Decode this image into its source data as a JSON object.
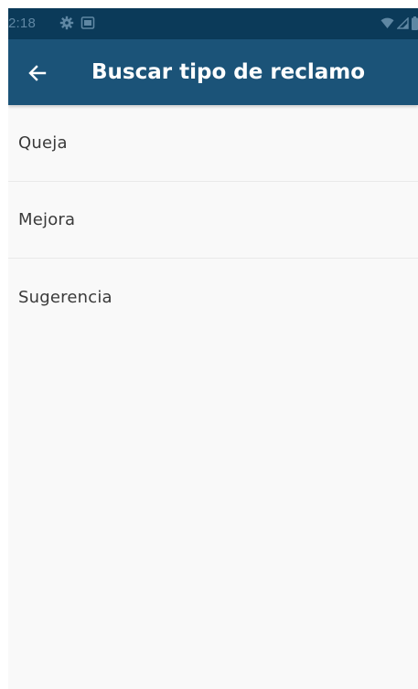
{
  "status_bar": {
    "time": "2:18",
    "left_icons": [
      "gear-icon",
      "image-icon"
    ],
    "right_icons": [
      "wifi-icon",
      "signal-icon",
      "battery-icon"
    ]
  },
  "app_bar": {
    "back_icon": "arrow-left-icon",
    "title": "Buscar tipo de reclamo"
  },
  "list": {
    "items": [
      {
        "label": "Queja"
      },
      {
        "label": "Mejora"
      },
      {
        "label": "Sugerencia"
      }
    ]
  },
  "colors": {
    "status_bar_bg": "#0b3a59",
    "app_bar_bg": "#1b5378",
    "page_bg": "#f9f9f9",
    "divider": "#e9e9e9",
    "list_text": "#3a3a3a"
  }
}
